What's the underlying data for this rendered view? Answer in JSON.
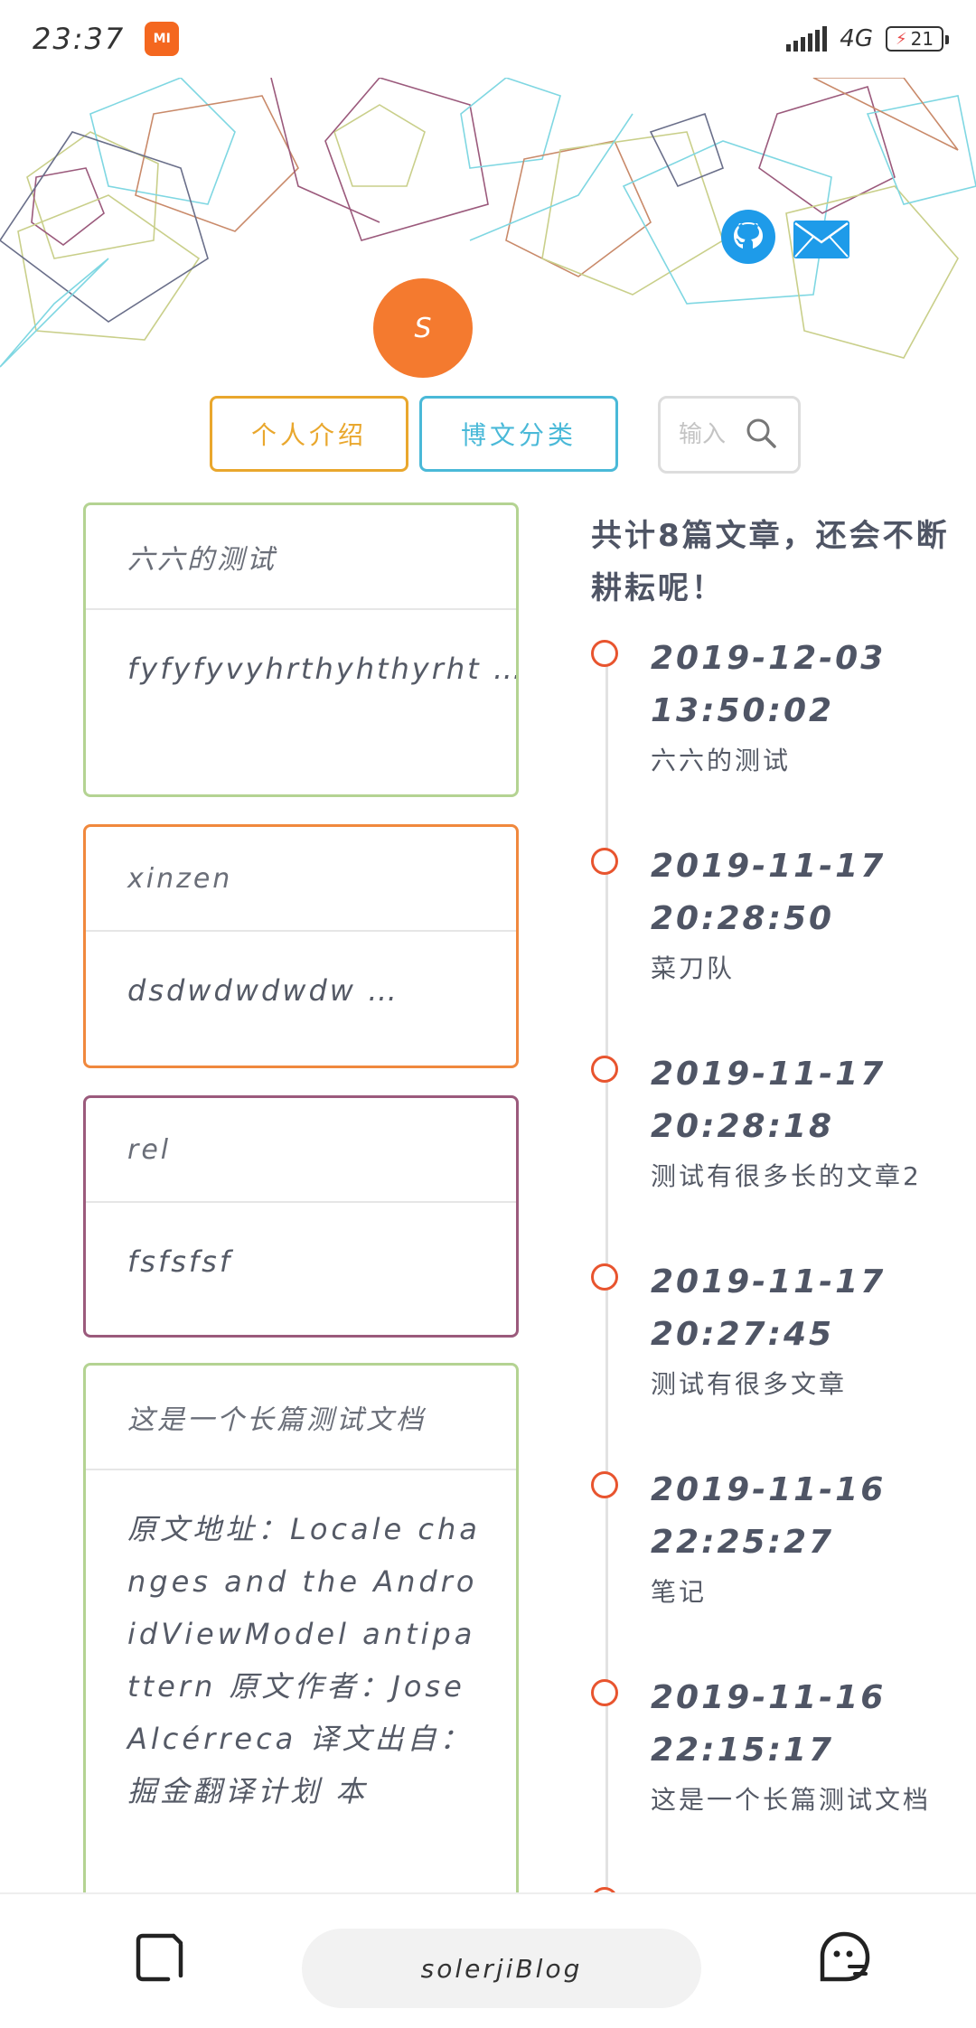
{
  "status_bar": {
    "time": "23:37",
    "mi_label": "MI",
    "network": "4G",
    "battery": "21"
  },
  "header": {
    "avatar_letter": "S"
  },
  "nav": {
    "about": "个人介绍",
    "categories": "博文分类",
    "search_placeholder": "输入"
  },
  "posts": [
    {
      "title": "六六的测试",
      "excerpt": "fyfyfyvyhrthyhthyrht\n…"
    },
    {
      "title": "xinzen",
      "excerpt": "dsdwdwdwdw …"
    },
    {
      "title": "rel",
      "excerpt": "fsfsfsf"
    },
    {
      "title": "这是一个长篇测试文档",
      "excerpt": "原文地址：Locale changes and the AndroidViewModel antipattern 原文作者：Jose Alcérreca 译文出自：掘金翻译计划 本"
    }
  ],
  "timeline": {
    "summary": "共计8篇文章，还会不断耕耘呢！",
    "items": [
      {
        "date": "2019-12-03 13:50:02",
        "title": "六六的测试"
      },
      {
        "date": "2019-11-17 20:28:50",
        "title": "菜刀队"
      },
      {
        "date": "2019-11-17 20:28:18",
        "title": "测试有很多长的文章2"
      },
      {
        "date": "2019-11-17 20:27:45",
        "title": "测试有很多文章"
      },
      {
        "date": "2019-11-16 22:25:27",
        "title": "笔记"
      },
      {
        "date": "2019-11-16 22:15:17",
        "title": "这是一个长篇测试文档"
      }
    ]
  },
  "bottom_bar": {
    "url": "solerjiBlog"
  },
  "colors": {
    "accent_orange": "#f47a2f",
    "about_button": "#e9a72d",
    "category_button": "#4ab9d8",
    "timeline_dot": "#e8542e",
    "github_blue": "#1e9be9"
  }
}
